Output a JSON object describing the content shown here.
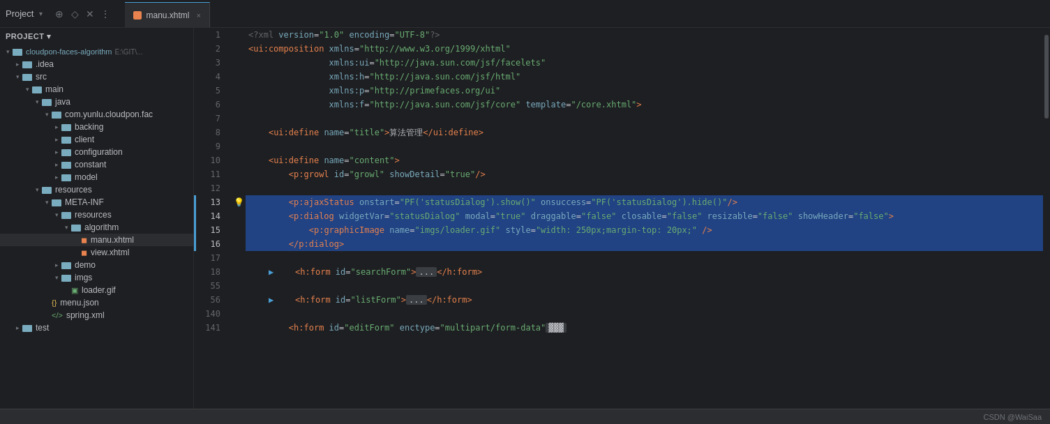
{
  "titleBar": {
    "projectLabel": "Project",
    "icons": [
      "compass",
      "diamond",
      "close",
      "more"
    ],
    "tab": {
      "name": "manu.xhtml",
      "closeLabel": "×"
    }
  },
  "sidebar": {
    "rootNode": {
      "label": "cloudpon-faces-algorithm",
      "path": "E:\\GIT\\..."
    },
    "tree": [
      {
        "id": "idea",
        "label": ".idea",
        "type": "folder",
        "depth": 1,
        "open": false
      },
      {
        "id": "src",
        "label": "src",
        "type": "folder",
        "depth": 1,
        "open": true
      },
      {
        "id": "main",
        "label": "main",
        "type": "folder",
        "depth": 2,
        "open": true
      },
      {
        "id": "java",
        "label": "java",
        "type": "folder",
        "depth": 3,
        "open": true
      },
      {
        "id": "com",
        "label": "com.yunlu.cloudpon.fac",
        "type": "folder",
        "depth": 4,
        "open": true
      },
      {
        "id": "backing",
        "label": "backing",
        "type": "folder",
        "depth": 5,
        "open": false
      },
      {
        "id": "client",
        "label": "client",
        "type": "folder",
        "depth": 5,
        "open": false
      },
      {
        "id": "configuration",
        "label": "configuration",
        "type": "folder",
        "depth": 5,
        "open": false
      },
      {
        "id": "constant",
        "label": "constant",
        "type": "folder",
        "depth": 5,
        "open": false
      },
      {
        "id": "model",
        "label": "model",
        "type": "folder",
        "depth": 5,
        "open": false
      },
      {
        "id": "resources",
        "label": "resources",
        "type": "folder",
        "depth": 3,
        "open": true
      },
      {
        "id": "meta-inf",
        "label": "META-INF",
        "type": "folder",
        "depth": 4,
        "open": true
      },
      {
        "id": "resources2",
        "label": "resources",
        "type": "folder",
        "depth": 4,
        "open": true
      },
      {
        "id": "algorithm",
        "label": "algorithm",
        "type": "folder",
        "depth": 5,
        "open": true
      },
      {
        "id": "manu",
        "label": "manu.xhtml",
        "type": "xhtml",
        "depth": 6,
        "selected": true
      },
      {
        "id": "view",
        "label": "view.xhtml",
        "type": "xhtml",
        "depth": 6
      },
      {
        "id": "demo",
        "label": "demo",
        "type": "folder",
        "depth": 4,
        "open": false
      },
      {
        "id": "imgs",
        "label": "imgs",
        "type": "folder",
        "depth": 4,
        "open": true
      },
      {
        "id": "loader",
        "label": "loader.gif",
        "type": "gif",
        "depth": 5
      },
      {
        "id": "menu-json",
        "label": "menu.json",
        "type": "json",
        "depth": 3
      },
      {
        "id": "spring-xml",
        "label": "spring.xml",
        "type": "spring",
        "depth": 3
      },
      {
        "id": "test",
        "label": "test",
        "type": "folder",
        "depth": 1,
        "open": false
      }
    ]
  },
  "editor": {
    "filename": "manu.xhtml",
    "lines": [
      {
        "num": 1,
        "content": "<?xml version=\"1.0\" encoding=\"UTF-8\"?>",
        "highlight": false
      },
      {
        "num": 2,
        "content": "<ui:composition xmlns=\"http://www.w3.org/1999/xhtml\"",
        "highlight": false
      },
      {
        "num": 3,
        "content": "                xmlns:ui=\"http://java.sun.com/jsf/facelets\"",
        "highlight": false
      },
      {
        "num": 4,
        "content": "                xmlns:h=\"http://java.sun.com/jsf/html\"",
        "highlight": false
      },
      {
        "num": 5,
        "content": "                xmlns:p=\"http://primefaces.org/ui\"",
        "highlight": false
      },
      {
        "num": 6,
        "content": "                xmlns:f=\"http://java.sun.com/jsf/core\" template=\"/core.xhtml\">",
        "highlight": false
      },
      {
        "num": 7,
        "content": "",
        "highlight": false
      },
      {
        "num": 8,
        "content": "    <ui:define name=\"title\">算法管理</ui:define>",
        "highlight": false
      },
      {
        "num": 9,
        "content": "",
        "highlight": false
      },
      {
        "num": 10,
        "content": "    <ui:define name=\"content\">",
        "highlight": false
      },
      {
        "num": 11,
        "content": "        <p:growl id=\"growl\" showDetail=\"true\"/>",
        "highlight": false
      },
      {
        "num": 12,
        "content": "",
        "highlight": false
      },
      {
        "num": 13,
        "content": "        <p:ajaxStatus onstart=\"PF('statusDialog').show()\" onsuccess=\"PF('statusDialog').hide()\"/>",
        "highlight": true
      },
      {
        "num": 14,
        "content": "        <p:dialog widgetVar=\"statusDialog\" modal=\"true\" draggable=\"false\" closable=\"false\" resizable=\"false\" showHeader=\"false\">",
        "highlight": true
      },
      {
        "num": 15,
        "content": "            <p:graphicImage name=\"imgs/loader.gif\" style=\"width: 250px;margin-top: 20px;\" />",
        "highlight": true
      },
      {
        "num": 16,
        "content": "        </p:dialog>",
        "highlight": true
      },
      {
        "num": 17,
        "content": "",
        "highlight": false
      },
      {
        "num": 18,
        "content": "        <h:form id=\"searchForm\">...</h:form>",
        "highlight": false,
        "collapsed": true
      },
      {
        "num": 55,
        "content": "",
        "highlight": false
      },
      {
        "num": 56,
        "content": "        <h:form id=\"listForm\">...</h:form>",
        "highlight": false,
        "collapsed": true
      },
      {
        "num": 140,
        "content": "",
        "highlight": false
      },
      {
        "num": 141,
        "content": "        <h:form id=\"editForm\" enctype=\"multipart/form-data\">",
        "highlight": false
      }
    ],
    "gutterMarks": [
      13,
      14,
      15,
      16
    ],
    "bulbLine": 13
  },
  "statusBar": {
    "text": "CSDN @WaiSaa"
  }
}
